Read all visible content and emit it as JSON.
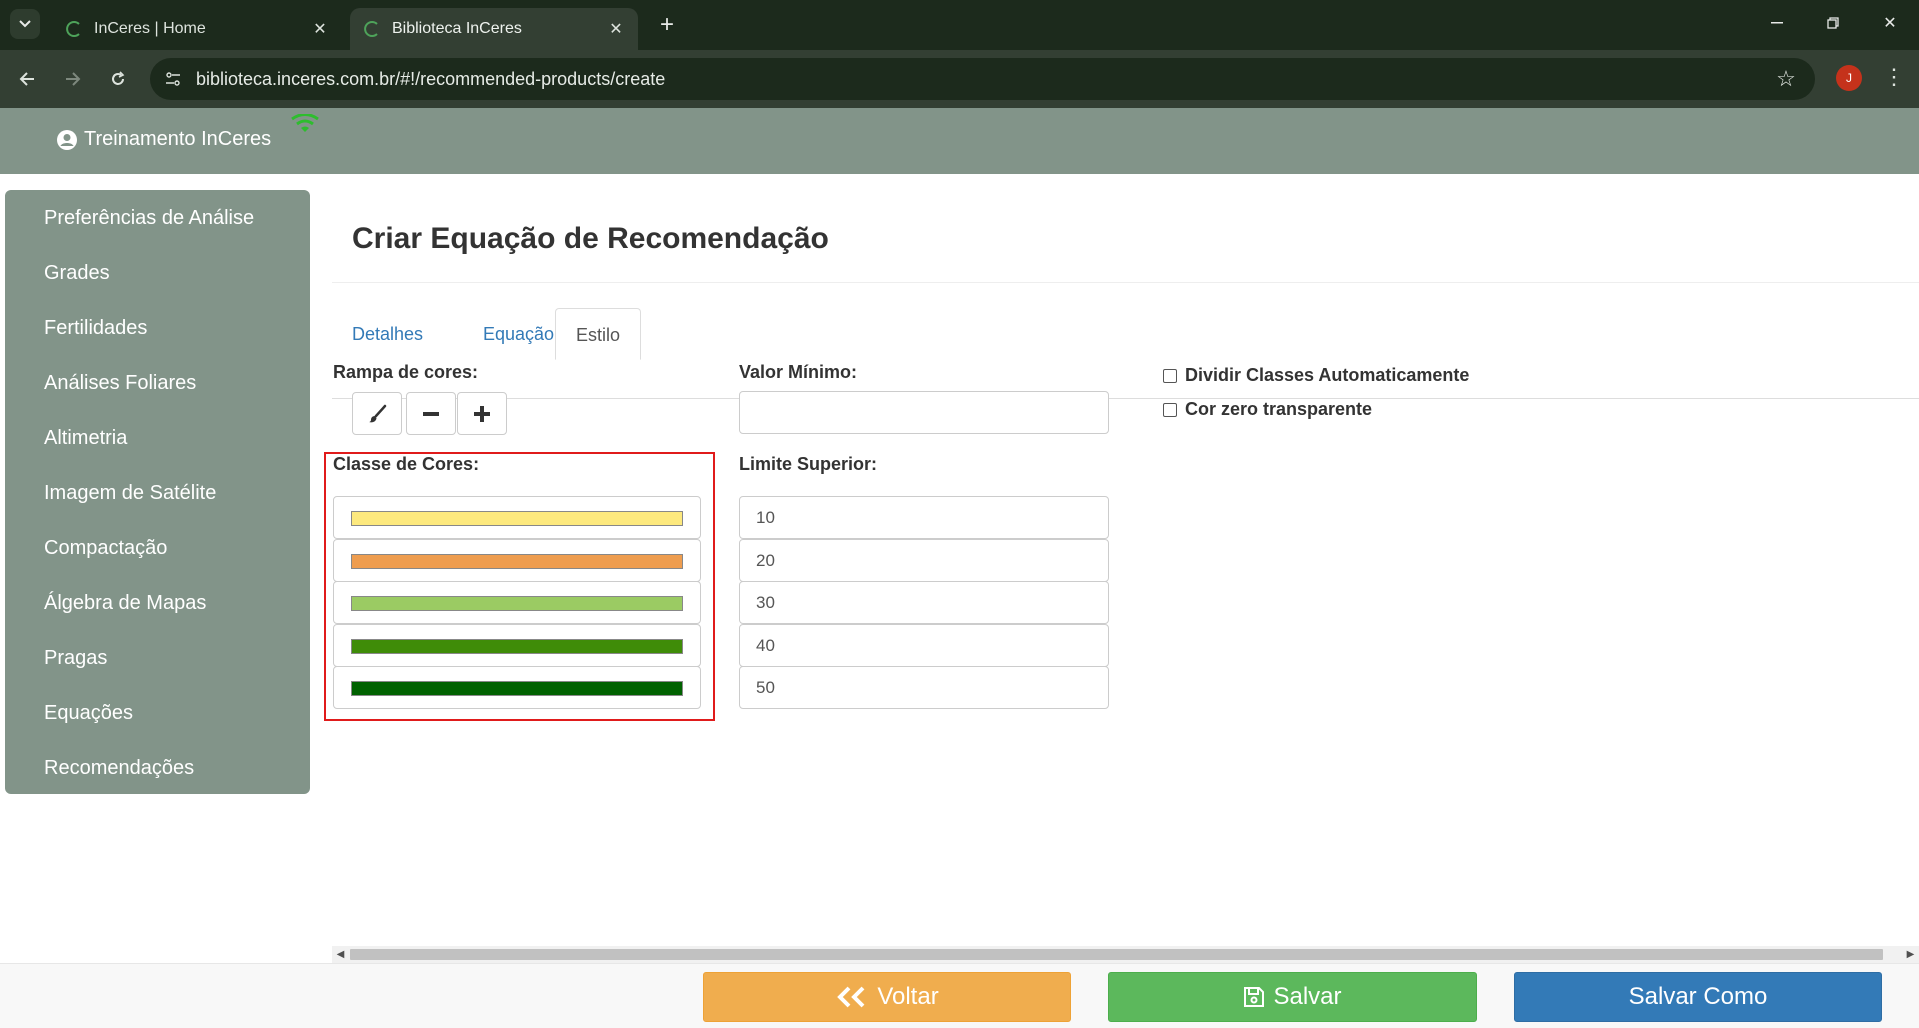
{
  "browser": {
    "tabs": [
      {
        "title": "InCeres | Home",
        "active": false
      },
      {
        "title": "Biblioteca InCeres",
        "active": true
      }
    ],
    "url": "biblioteca.inceres.com.br/#!/recommended-products/create",
    "profile_initial": "J"
  },
  "header": {
    "user": "Treinamento InCeres"
  },
  "sidebar": {
    "items": [
      {
        "label": "Preferências de Análise"
      },
      {
        "label": "Grades"
      },
      {
        "label": "Fertilidades"
      },
      {
        "label": "Análises Foliares"
      },
      {
        "label": "Altimetria"
      },
      {
        "label": "Imagem de Satélite"
      },
      {
        "label": "Compactação"
      },
      {
        "label": "Álgebra de Mapas"
      },
      {
        "label": "Pragas"
      },
      {
        "label": "Equações"
      },
      {
        "label": "Recomendações"
      }
    ]
  },
  "main": {
    "title": "Criar Equação de Recomendação",
    "tabs": [
      {
        "label": "Detalhes"
      },
      {
        "label": "Equação"
      },
      {
        "label": "Estilo"
      }
    ],
    "active_tab": "Estilo",
    "color_ramp_label": "Rampa de cores:",
    "min_value_label": "Valor Mínimo:",
    "min_value": "",
    "color_classes_label": "Classe de Cores:",
    "upper_limit_label": "Limite Superior:",
    "color_classes": [
      {
        "color": "#fde97e",
        "upper_limit": "10"
      },
      {
        "color": "#ee9d4f",
        "upper_limit": "20"
      },
      {
        "color": "#9bcb63",
        "upper_limit": "30"
      },
      {
        "color": "#3f8c08",
        "upper_limit": "40"
      },
      {
        "color": "#006100",
        "upper_limit": "50"
      }
    ],
    "checkboxes": [
      {
        "label": "Dividir Classes Automaticamente",
        "checked": false
      },
      {
        "label": "Cor zero transparente",
        "checked": false
      }
    ]
  },
  "footer": {
    "back_label": "Voltar",
    "save_label": "Salvar",
    "save_as_label": "Salvar Como"
  },
  "colors": {
    "header_bg": "#829489",
    "highlight": "#e01b1b",
    "back": "#f0ad4e",
    "save": "#5cb85c",
    "save_as": "#337ab7"
  }
}
